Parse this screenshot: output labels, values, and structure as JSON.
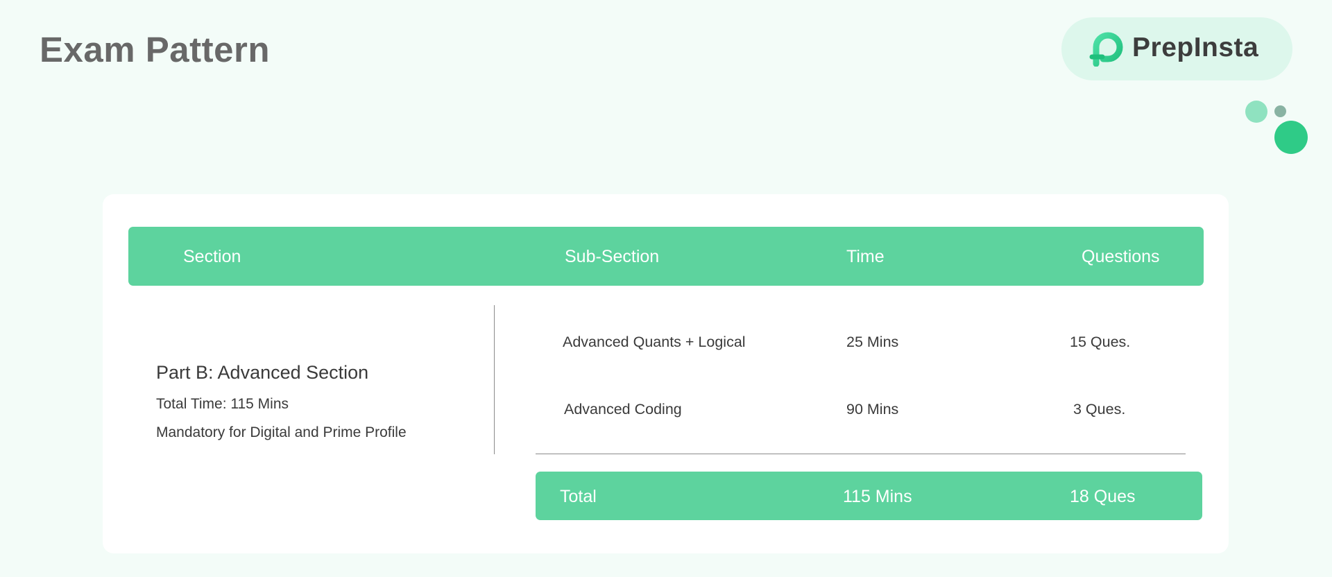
{
  "page": {
    "title": "Exam Pattern"
  },
  "brand": {
    "name": "PrepInsta",
    "logo_icon": "prepinsta-logo-icon",
    "accent": "#2fcb87"
  },
  "colors": {
    "header_bg": "#5dd39e",
    "page_bg": "#f3fcf8",
    "card_bg": "#ffffff"
  },
  "table": {
    "headers": {
      "section": "Section",
      "subsection": "Sub-Section",
      "time": "Time",
      "questions": "Questions"
    },
    "section": {
      "name": "Part B: Advanced Section",
      "total_time": "Total Time: 115 Mins",
      "note": "Mandatory for Digital and Prime Profile"
    },
    "rows": [
      {
        "subsection": "Advanced Quants + Logical",
        "time": "25 Mins",
        "questions": "15 Ques."
      },
      {
        "subsection": "Advanced Coding",
        "time": "90 Mins",
        "questions": "3 Ques."
      }
    ],
    "total": {
      "label": "Total",
      "time": "115 Mins",
      "questions": "18 Ques"
    }
  }
}
